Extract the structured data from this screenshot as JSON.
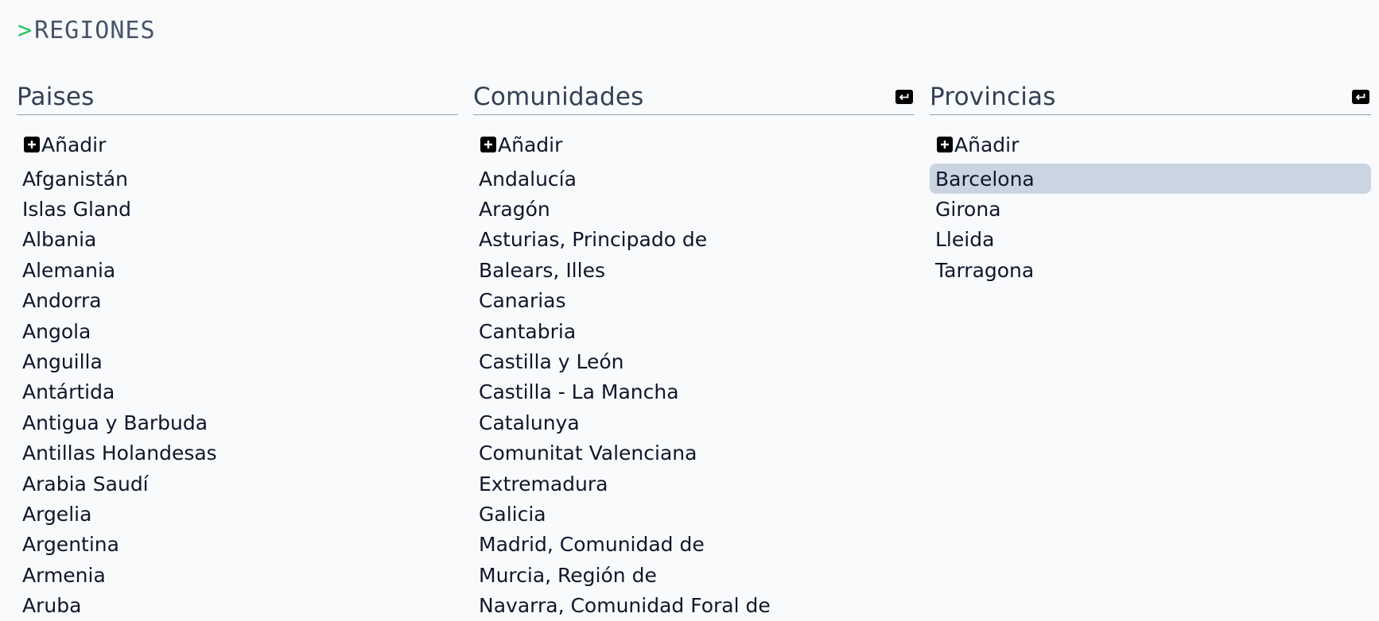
{
  "header": {
    "prompt": ">",
    "title": "REGIONES"
  },
  "columns": {
    "paises": {
      "title": "Paises",
      "add_label": "Añadir",
      "items": [
        "Afganistán",
        "Islas Gland",
        "Albania",
        "Alemania",
        "Andorra",
        "Angola",
        "Anguilla",
        "Antártida",
        "Antigua y Barbuda",
        "Antillas Holandesas",
        "Arabia Saudí",
        "Argelia",
        "Argentina",
        "Armenia",
        "Aruba"
      ]
    },
    "comunidades": {
      "title": "Comunidades",
      "add_label": "Añadir",
      "items": [
        "Andalucía",
        "Aragón",
        "Asturias, Principado de",
        "Balears, Illes",
        "Canarias",
        "Cantabria",
        "Castilla y León",
        "Castilla - La Mancha",
        "Catalunya",
        "Comunitat Valenciana",
        "Extremadura",
        "Galicia",
        "Madrid, Comunidad de",
        "Murcia, Región de",
        "Navarra, Comunidad Foral de"
      ]
    },
    "provincias": {
      "title": "Provincias",
      "add_label": "Añadir",
      "items": [
        "Barcelona",
        "Girona",
        "Lleida",
        "Tarragona"
      ],
      "selected": "Barcelona"
    }
  },
  "colors": {
    "background": "#f8fafc",
    "prompt": "#22c55e",
    "selected_bg": "#cbd5e1",
    "rule": "#94a3b8"
  },
  "icons": {
    "add": "plus-square-icon",
    "return": "return-arrow-icon"
  }
}
